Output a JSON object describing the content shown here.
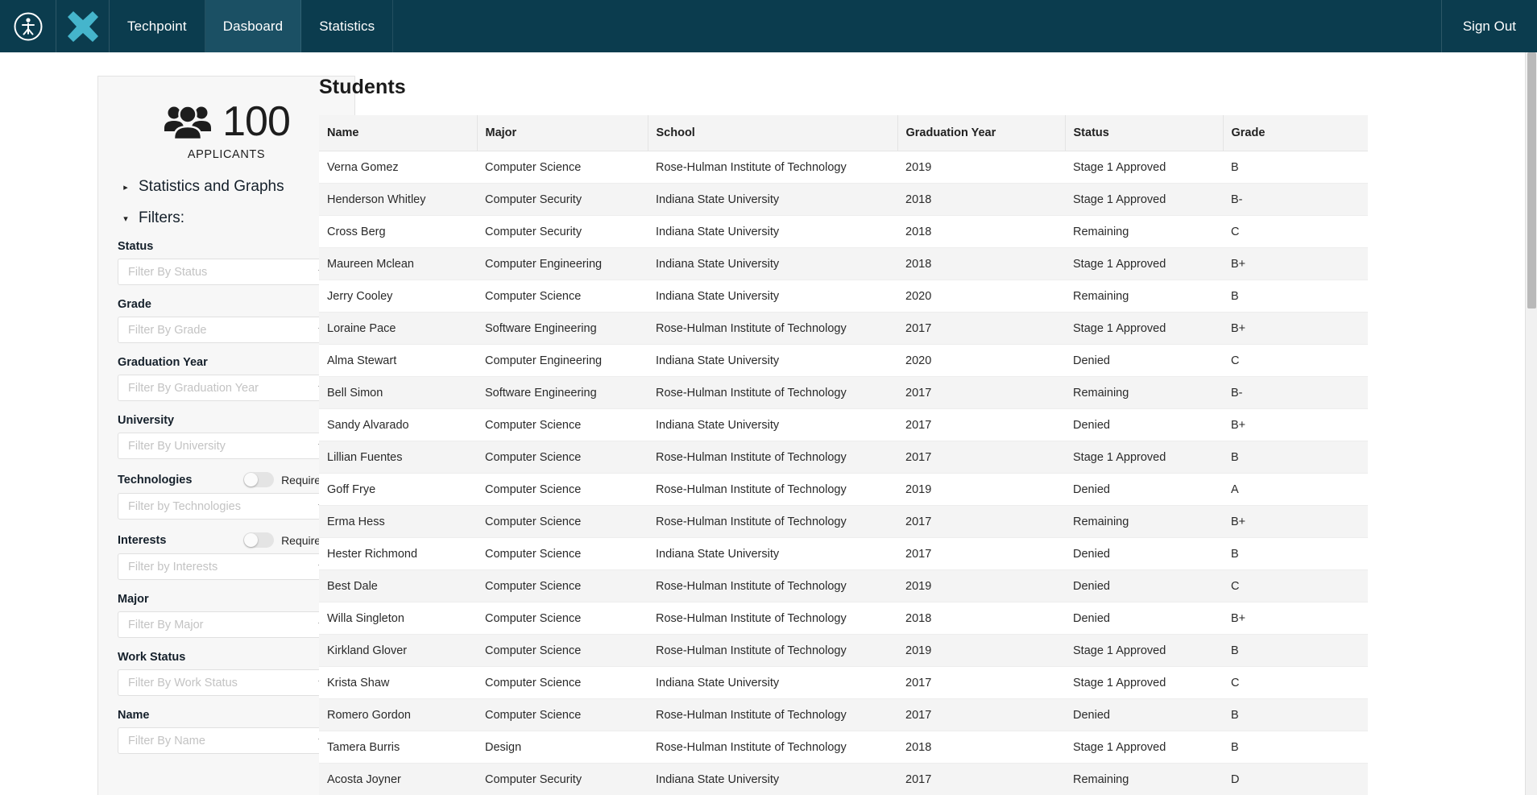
{
  "navbar": {
    "logo_icon": "person-in-circle-logo-icon",
    "brand_icon": "x-mark-brand-icon",
    "items": [
      {
        "label": "Techpoint",
        "active": false
      },
      {
        "label": "Dasboard",
        "active": true
      },
      {
        "label": "Statistics",
        "active": false
      }
    ],
    "sign_out_label": "Sign Out",
    "background_color": "#0b3c4e",
    "active_tab_color": "#1b5064",
    "brand_color": "#45b5cc"
  },
  "sidebar": {
    "applicants": {
      "icon": "users-group-icon",
      "count": "100",
      "label": "APPLICANTS"
    },
    "sections": [
      {
        "label": "Statistics and Graphs",
        "caret": "caret-right-icon",
        "expanded": false
      },
      {
        "label": "Filters:",
        "caret": "caret-down-icon",
        "expanded": true
      }
    ],
    "filters": [
      {
        "name": "status",
        "label": "Status",
        "placeholder": "Filter By Status",
        "value": "",
        "has_toggle": false
      },
      {
        "name": "grade",
        "label": "Grade",
        "placeholder": "Filter By Grade",
        "value": "",
        "has_toggle": false
      },
      {
        "name": "graduation-year",
        "label": "Graduation Year",
        "placeholder": "Filter By Graduation Year",
        "value": "",
        "has_toggle": false
      },
      {
        "name": "university",
        "label": "University",
        "placeholder": "Filter By University",
        "value": "",
        "has_toggle": false
      },
      {
        "name": "technologies",
        "label": "Technologies",
        "placeholder": "Filter by Technologies",
        "value": "",
        "has_toggle": true,
        "toggle_label": "Require all",
        "toggle_on": false
      },
      {
        "name": "interests",
        "label": "Interests",
        "placeholder": "Filter by Interests",
        "value": "",
        "has_toggle": true,
        "toggle_label": "Require all",
        "toggle_on": false
      },
      {
        "name": "major",
        "label": "Major",
        "placeholder": "Filter By Major",
        "value": "",
        "has_toggle": false
      },
      {
        "name": "work-status",
        "label": "Work Status",
        "placeholder": "Filter By Work Status",
        "value": "",
        "has_toggle": false
      },
      {
        "name": "name",
        "label": "Name",
        "placeholder": "Filter By Name",
        "value": "",
        "has_toggle": false
      }
    ]
  },
  "main": {
    "title": "Students",
    "table": {
      "columns": [
        "Name",
        "Major",
        "School",
        "Graduation Year",
        "Status",
        "Grade"
      ],
      "rows": [
        [
          "Verna Gomez",
          "Computer Science",
          "Rose-Hulman Institute of Technology",
          "2019",
          "Stage 1 Approved",
          "B"
        ],
        [
          "Henderson Whitley",
          "Computer Security",
          "Indiana State University",
          "2018",
          "Stage 1 Approved",
          "B-"
        ],
        [
          "Cross Berg",
          "Computer Security",
          "Indiana State University",
          "2018",
          "Remaining",
          "C"
        ],
        [
          "Maureen Mclean",
          "Computer Engineering",
          "Indiana State University",
          "2018",
          "Stage 1 Approved",
          "B+"
        ],
        [
          "Jerry Cooley",
          "Computer Science",
          "Indiana State University",
          "2020",
          "Remaining",
          "B"
        ],
        [
          "Loraine Pace",
          "Software Engineering",
          "Rose-Hulman Institute of Technology",
          "2017",
          "Stage 1 Approved",
          "B+"
        ],
        [
          "Alma Stewart",
          "Computer Engineering",
          "Indiana State University",
          "2020",
          "Denied",
          "C"
        ],
        [
          "Bell Simon",
          "Software Engineering",
          "Rose-Hulman Institute of Technology",
          "2017",
          "Remaining",
          "B-"
        ],
        [
          "Sandy Alvarado",
          "Computer Science",
          "Indiana State University",
          "2017",
          "Denied",
          "B+"
        ],
        [
          "Lillian Fuentes",
          "Computer Science",
          "Rose-Hulman Institute of Technology",
          "2017",
          "Stage 1 Approved",
          "B"
        ],
        [
          "Goff Frye",
          "Computer Science",
          "Rose-Hulman Institute of Technology",
          "2019",
          "Denied",
          "A"
        ],
        [
          "Erma Hess",
          "Computer Science",
          "Rose-Hulman Institute of Technology",
          "2017",
          "Remaining",
          "B+"
        ],
        [
          "Hester Richmond",
          "Computer Science",
          "Indiana State University",
          "2017",
          "Denied",
          "B"
        ],
        [
          "Best Dale",
          "Computer Science",
          "Rose-Hulman Institute of Technology",
          "2019",
          "Denied",
          "C"
        ],
        [
          "Willa Singleton",
          "Computer Science",
          "Rose-Hulman Institute of Technology",
          "2018",
          "Denied",
          "B+"
        ],
        [
          "Kirkland Glover",
          "Computer Science",
          "Rose-Hulman Institute of Technology",
          "2019",
          "Stage 1 Approved",
          "B"
        ],
        [
          "Krista Shaw",
          "Computer Science",
          "Indiana State University",
          "2017",
          "Stage 1 Approved",
          "C"
        ],
        [
          "Romero Gordon",
          "Computer Science",
          "Rose-Hulman Institute of Technology",
          "2017",
          "Denied",
          "B"
        ],
        [
          "Tamera Burris",
          "Design",
          "Rose-Hulman Institute of Technology",
          "2018",
          "Stage 1 Approved",
          "B"
        ],
        [
          "Acosta Joyner",
          "Computer Security",
          "Indiana State University",
          "2017",
          "Remaining",
          "D"
        ]
      ]
    }
  },
  "scrollbar": {
    "name": "page-scrollbar"
  }
}
